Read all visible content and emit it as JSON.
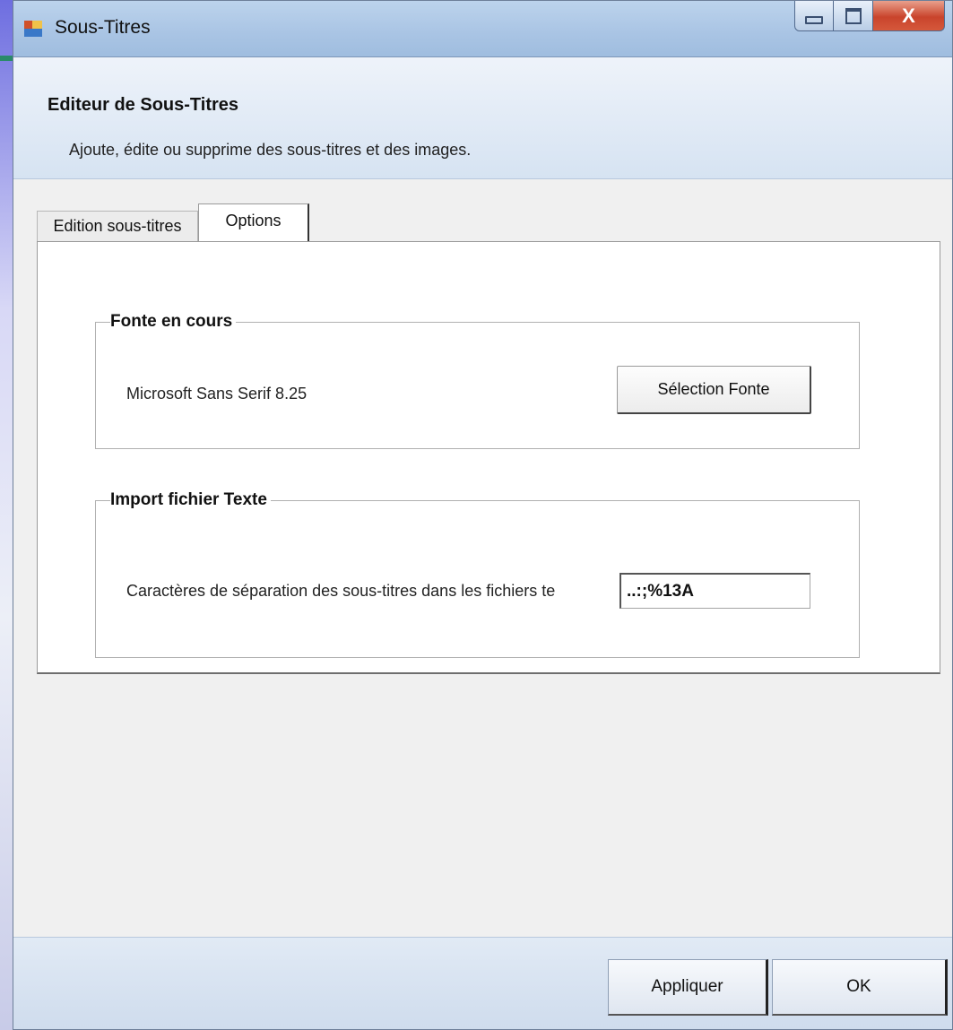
{
  "window": {
    "title": "Sous-Titres",
    "close_label": "X"
  },
  "header": {
    "title": "Editeur de Sous-Titres",
    "subtitle": "Ajoute, édite ou supprime des sous-titres et des images."
  },
  "tabs": [
    {
      "label": "Edition sous-titres",
      "selected": false
    },
    {
      "label": "Options",
      "selected": true
    }
  ],
  "options": {
    "font_group": {
      "title": "Fonte en cours",
      "current_font": "Microsoft Sans Serif 8.25",
      "select_button": "Sélection Fonte"
    },
    "import_group": {
      "title": "Import fichier Texte",
      "separator_label": "Caractères de séparation des sous-titres dans les fichiers te",
      "separator_value": "..:;%13A"
    }
  },
  "footer": {
    "apply_label": "Appliquer",
    "ok_label": "OK"
  },
  "colors": {
    "titlebar": "#a9c4e4",
    "close_button": "#c9442c",
    "dialog_background": "#f0f0f0"
  }
}
